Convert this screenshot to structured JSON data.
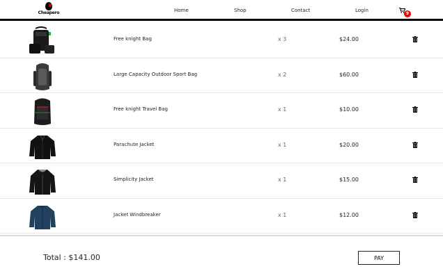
{
  "brand": {
    "name": "Cheapero",
    "logo_icon": "brand-logo-icon"
  },
  "nav": {
    "links": [
      "Home",
      "Shop",
      "Contact",
      "Login"
    ],
    "cart_count": "9",
    "cart_icon": "shopping-cart-icon"
  },
  "cart": {
    "items": [
      {
        "name": "Free knight Bag",
        "qty": "x 3",
        "price": "$24.00",
        "image": "black-tactical-bag-image"
      },
      {
        "name": "Large Capacity Outdoor Sport Bag",
        "qty": "x 2",
        "price": "$60.00",
        "image": "grey-outdoor-sport-backpack-image"
      },
      {
        "name": "Free knight Travel Bag",
        "qty": "x 1",
        "price": "$10.00",
        "image": "black-travel-backpack-image"
      },
      {
        "name": "Parachute Jacket",
        "qty": "x 1",
        "price": "$20.00",
        "image": "black-parachute-jacket-image"
      },
      {
        "name": "Simplicity Jacket",
        "qty": "x 1",
        "price": "$15.00",
        "image": "black-hooded-jacket-image"
      },
      {
        "name": "Jacket Windbreaker",
        "qty": "x 1",
        "price": "$12.00",
        "image": "navy-windbreaker-jacket-image"
      }
    ],
    "delete_icon": "trash-icon"
  },
  "footer": {
    "total": "Total : $141.00",
    "pay_label": "PAY"
  },
  "colors": {
    "accent_badge": "#e00000",
    "nav_border": "#000000",
    "text": "#222222"
  }
}
